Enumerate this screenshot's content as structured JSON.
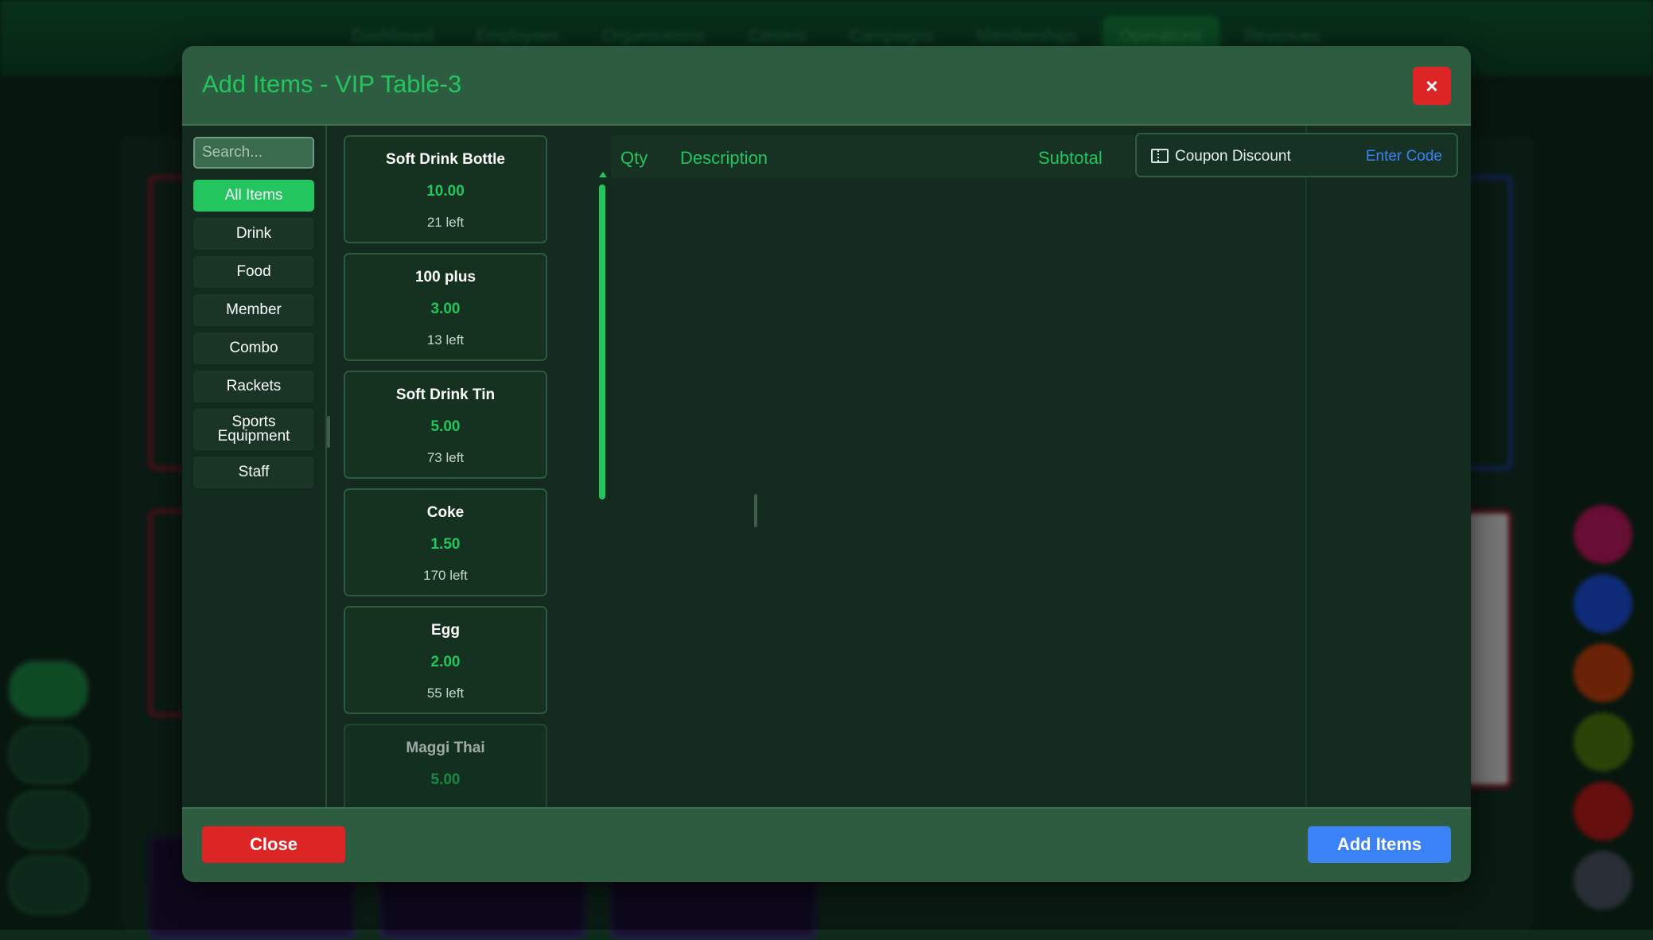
{
  "background": {
    "nav": [
      "Dashboard",
      "Employees",
      "Organisations",
      "Centers",
      "Campaigns",
      "Memberships",
      "Operations",
      "Revenues"
    ],
    "nav_active": "Operations"
  },
  "modal": {
    "title": "Add Items - VIP Table-3",
    "close_icon": "×"
  },
  "search": {
    "placeholder": "Search...",
    "value": ""
  },
  "categories": [
    {
      "label": "All Items",
      "active": true
    },
    {
      "label": "Drink",
      "active": false
    },
    {
      "label": "Food",
      "active": false
    },
    {
      "label": "Member",
      "active": false
    },
    {
      "label": "Combo",
      "active": false
    },
    {
      "label": "Rackets",
      "active": false
    },
    {
      "label": "Sports\nEquipment",
      "active": false
    },
    {
      "label": "Staff",
      "active": false
    }
  ],
  "products": [
    {
      "name": "Soft Drink Bottle",
      "price": "10.00",
      "stock": "21 left"
    },
    {
      "name": "100 plus",
      "price": "3.00",
      "stock": "13 left"
    },
    {
      "name": "Soft Drink Tin",
      "price": "5.00",
      "stock": "73 left"
    },
    {
      "name": "Coke",
      "price": "1.50",
      "stock": "170 left"
    },
    {
      "name": "Egg",
      "price": "2.00",
      "stock": "55 left"
    },
    {
      "name": "Maggi Thai",
      "price": "5.00",
      "stock": ""
    }
  ],
  "order_table": {
    "headers": {
      "qty": "Qty",
      "description": "Description",
      "subtotal": "Subtotal"
    },
    "rows": []
  },
  "coupon": {
    "label": "Coupon Discount",
    "link": "Enter Code",
    "icon": "ticket-icon"
  },
  "footer": {
    "close_label": "Close",
    "add_label": "Add Items"
  },
  "colors": {
    "accent": "#22c55e",
    "danger": "#dc2626",
    "primary": "#3b82f6",
    "header_bg": "#2d5c41",
    "body_bg": "#122b1e"
  }
}
